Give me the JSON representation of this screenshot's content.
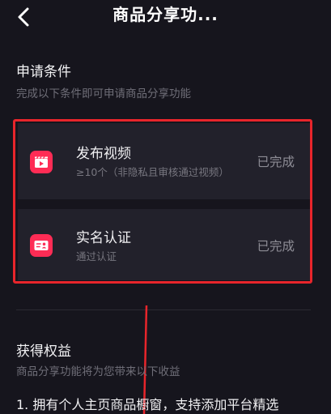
{
  "nav": {
    "title": "商品分享功..."
  },
  "conditions": {
    "title": "申请条件",
    "subtitle": "完成以下条件即可申请商品分享功能",
    "items": [
      {
        "icon": "clapperboard-icon",
        "title": "发布视频",
        "desc": "≥10个（非隐私且审核通过视频）",
        "status": "已完成"
      },
      {
        "icon": "id-card-icon",
        "title": "实名认证",
        "desc": "通过认证",
        "status": "已完成"
      }
    ]
  },
  "benefits": {
    "title": "获得权益",
    "subtitle": "商品分享功能将为您带来以下收益",
    "items": [
      "1. 拥有个人主页商品橱窗，支持添加平台精选"
    ]
  },
  "colors": {
    "background": "#16151d",
    "card": "#22212b",
    "accent": "#fe2c55",
    "highlight": "#e8252b"
  }
}
